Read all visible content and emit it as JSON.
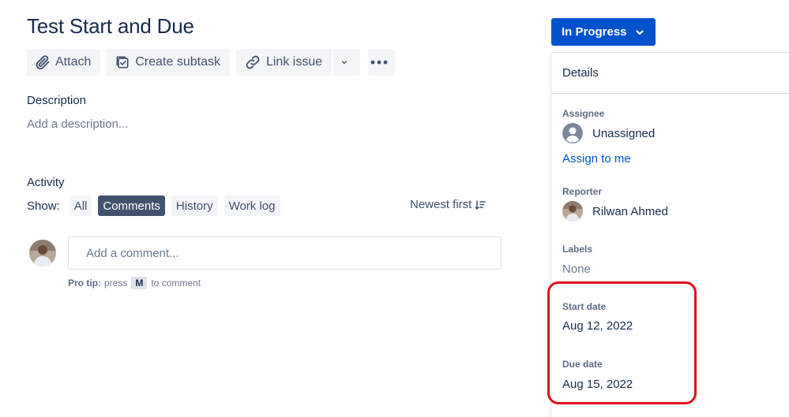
{
  "issue": {
    "title": "Test Start and Due"
  },
  "toolbar": {
    "attach_label": "Attach",
    "create_subtask_label": "Create subtask",
    "link_issue_label": "Link issue"
  },
  "description": {
    "label": "Description",
    "placeholder": "Add a description..."
  },
  "activity": {
    "label": "Activity",
    "show_label": "Show:",
    "filters": [
      {
        "label": "All",
        "active": false
      },
      {
        "label": "Comments",
        "active": true
      },
      {
        "label": "History",
        "active": false
      },
      {
        "label": "Work log",
        "active": false
      }
    ],
    "sort_label": "Newest first",
    "comment_placeholder": "Add a comment...",
    "protip": {
      "prefix": "Pro tip:",
      "press": "press",
      "key": "M",
      "suffix": "to comment"
    }
  },
  "status": {
    "label": "In Progress",
    "color": "#0052cc"
  },
  "details": {
    "heading": "Details",
    "assignee": {
      "label": "Assignee",
      "value": "Unassigned",
      "action": "Assign to me"
    },
    "reporter": {
      "label": "Reporter",
      "value": "Rilwan Ahmed"
    },
    "labels": {
      "label": "Labels",
      "value": "None"
    },
    "start_date": {
      "label": "Start date",
      "value": "Aug 12, 2022"
    },
    "due_date": {
      "label": "Due date",
      "value": "Aug 15, 2022"
    }
  },
  "icons": {
    "attach": "paperclip-icon",
    "subtask": "checkbox-icon",
    "link": "link-icon",
    "dropdown": "chevron-down-icon",
    "more": "more-horizontal-icon",
    "sort": "sort-descending-icon",
    "assignee": "unassigned-user-icon"
  },
  "colors": {
    "highlight": "#e0101c",
    "link": "#0052cc",
    "active_filter": "#42526e"
  }
}
